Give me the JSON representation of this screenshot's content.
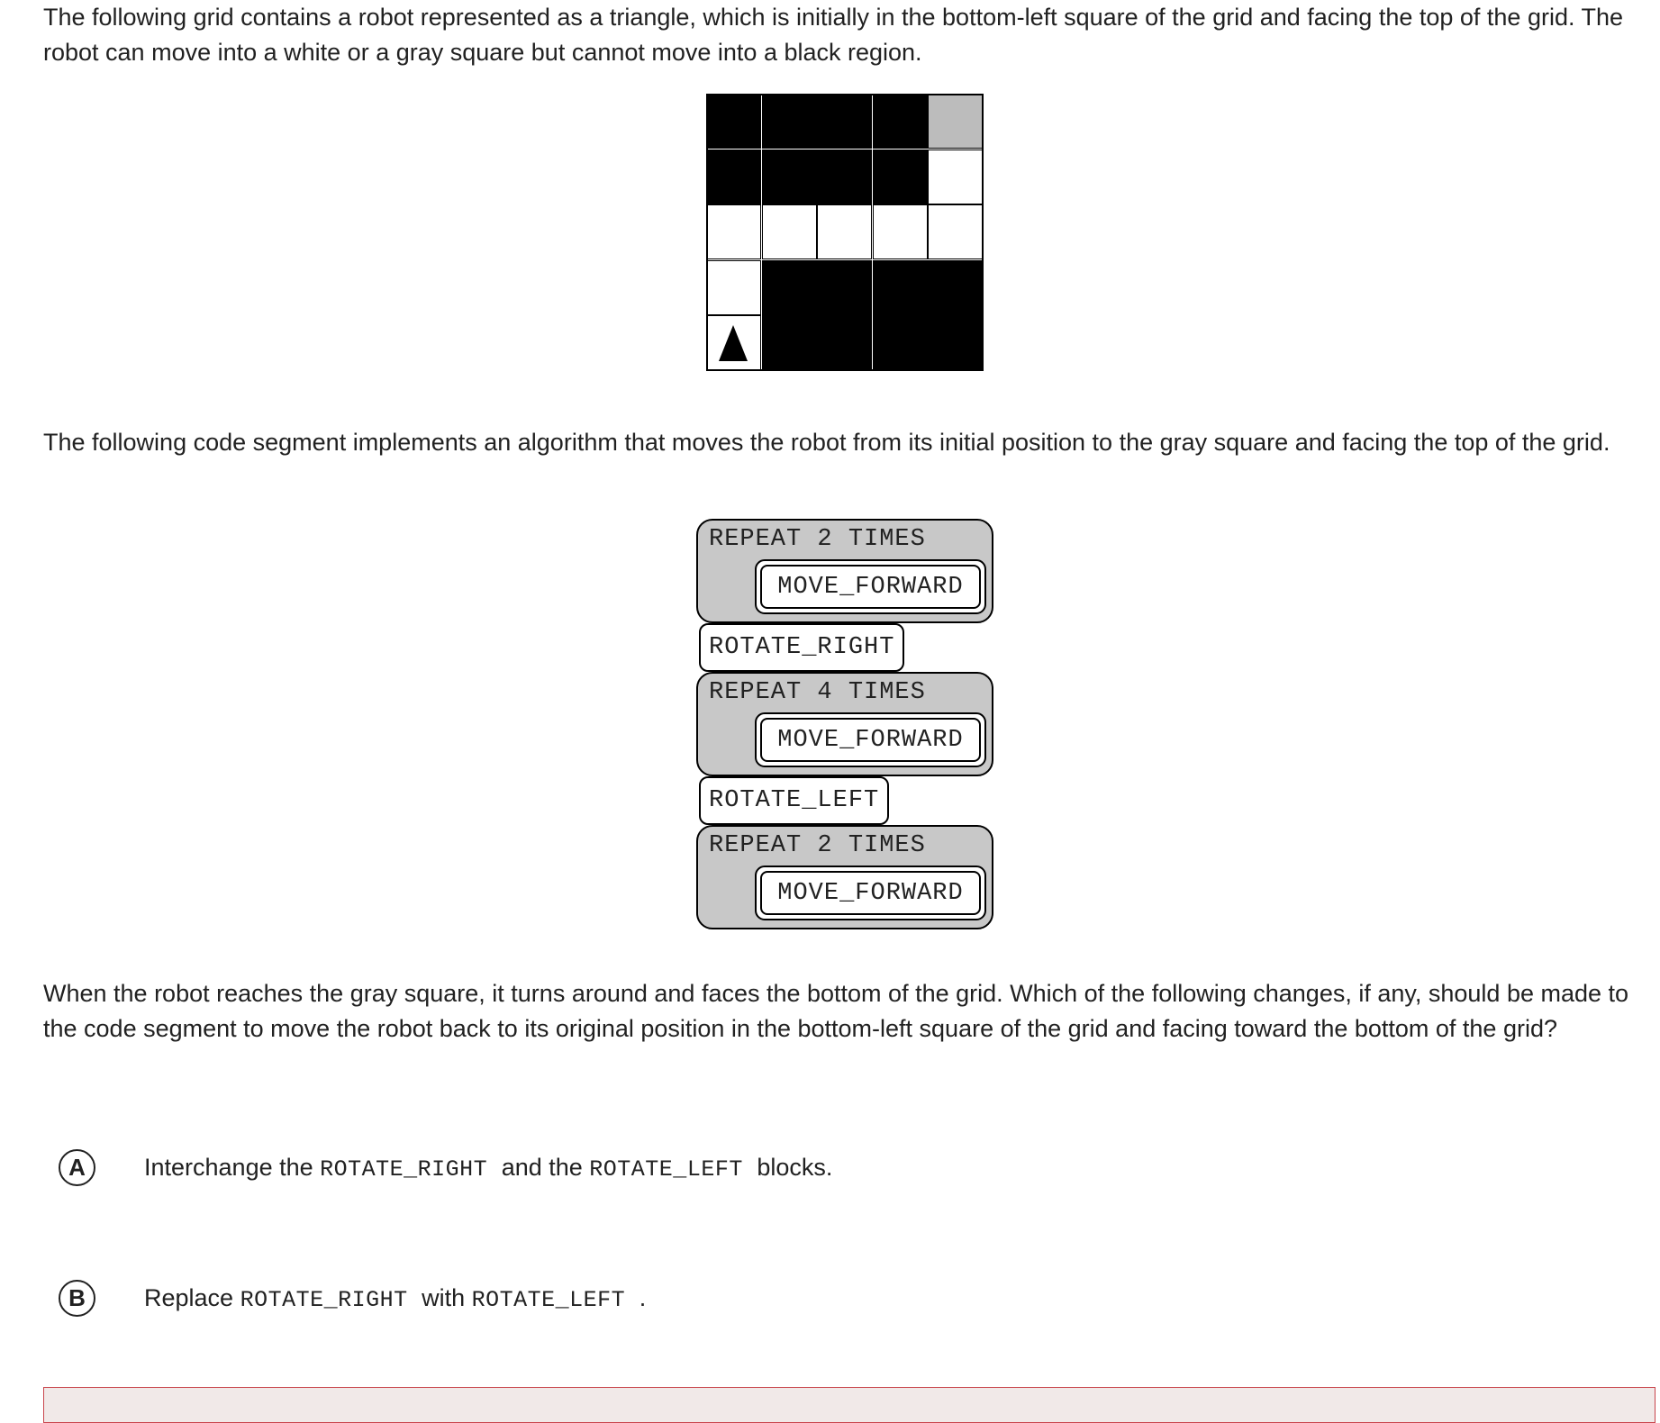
{
  "intro_text": "The following grid contains a robot represented as a triangle, which is initially in the bottom-left square of the grid and facing the top of the grid. The robot can move into a white or a gray square but cannot move into a black region.",
  "grid": {
    "rows": [
      [
        "b",
        "b",
        "b",
        "b",
        "g"
      ],
      [
        "b",
        "b",
        "b",
        "b",
        "w"
      ],
      [
        "w",
        "w",
        "w",
        "w",
        "w"
      ],
      [
        "w",
        "b",
        "b",
        "b",
        "b"
      ],
      [
        "r",
        "b",
        "b",
        "b",
        "b"
      ]
    ],
    "colors": {
      "white": "#ffffff",
      "gray": "#bcbcbc",
      "black": "#000000"
    },
    "robot_icon": "triangle-up"
  },
  "code_intro_text": "The following code segment implements an algorithm that moves the robot from its initial position to the gray square and facing the top of the grid.",
  "code_blocks": [
    {
      "type": "repeat",
      "header": "REPEAT 2 TIMES",
      "body": "MOVE_FORWARD"
    },
    {
      "type": "command",
      "label": "ROTATE_RIGHT"
    },
    {
      "type": "repeat",
      "header": "REPEAT 4 TIMES",
      "body": "MOVE_FORWARD"
    },
    {
      "type": "command",
      "label": "ROTATE_LEFT"
    },
    {
      "type": "repeat",
      "header": "REPEAT 2 TIMES",
      "body": "MOVE_FORWARD"
    }
  ],
  "question_text": "When the robot reaches the gray square, it turns around and faces the bottom of the grid. Which of the following changes, if any, should be made to the code segment to move the robot back to its original position in the bottom-left square of the grid and facing toward the bottom of the grid?",
  "options": [
    {
      "letter": "A",
      "parts": [
        {
          "t": "Interchange the "
        },
        {
          "c": "ROTATE_RIGHT"
        },
        {
          "t": " and the "
        },
        {
          "c": "ROTATE_LEFT"
        },
        {
          "t": " blocks."
        }
      ]
    },
    {
      "letter": "B",
      "parts": [
        {
          "t": "Replace "
        },
        {
          "c": "ROTATE_RIGHT"
        },
        {
          "t": " with "
        },
        {
          "c": "ROTATE_LEFT"
        },
        {
          "t": "."
        }
      ]
    }
  ],
  "accent_colors": {
    "text": "#212121",
    "block_fill": "#c8c8c8",
    "selection_border": "#c9454c",
    "selection_fill": "#f1e9e8"
  }
}
